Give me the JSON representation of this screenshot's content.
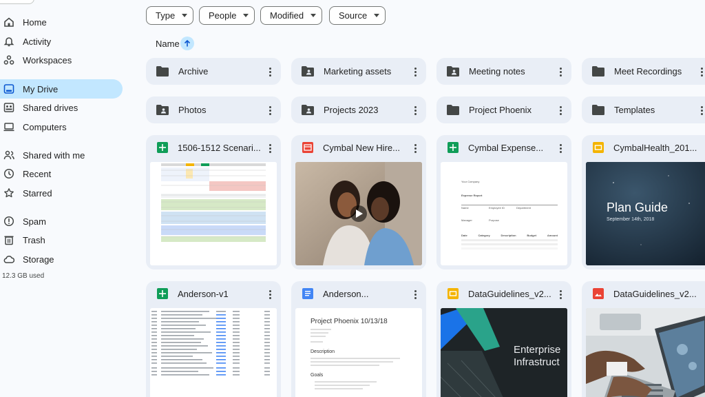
{
  "sidebar": {
    "items": [
      {
        "label": "Home",
        "icon": "home-icon"
      },
      {
        "label": "Activity",
        "icon": "bell-icon"
      },
      {
        "label": "Workspaces",
        "icon": "workspaces-icon"
      },
      {
        "label": "My Drive",
        "icon": "drive-icon",
        "active": true
      },
      {
        "label": "Shared drives",
        "icon": "shared-drives-icon"
      },
      {
        "label": "Computers",
        "icon": "computer-icon"
      },
      {
        "label": "Shared with me",
        "icon": "people-icon"
      },
      {
        "label": "Recent",
        "icon": "clock-icon"
      },
      {
        "label": "Starred",
        "icon": "star-icon"
      },
      {
        "label": "Spam",
        "icon": "spam-icon"
      },
      {
        "label": "Trash",
        "icon": "trash-icon"
      },
      {
        "label": "Storage",
        "icon": "cloud-icon"
      }
    ],
    "storage_used": "12.3 GB used"
  },
  "filters": [
    "Type",
    "People",
    "Modified",
    "Source"
  ],
  "sort": {
    "label": "Name",
    "direction": "ascending"
  },
  "folders": [
    {
      "name": "Archive",
      "shared": false
    },
    {
      "name": "Marketing assets",
      "shared": true
    },
    {
      "name": "Meeting notes",
      "shared": true
    },
    {
      "name": "Meet Recordings",
      "shared": false
    },
    {
      "name": "Photos",
      "shared": true
    },
    {
      "name": "Projects 2023",
      "shared": true
    },
    {
      "name": "Project Phoenix",
      "shared": false
    },
    {
      "name": "Templates",
      "shared": false
    }
  ],
  "files": [
    {
      "name": "1506-1512 Scenari...",
      "type": "sheet"
    },
    {
      "name": "Cymbal New Hire...",
      "type": "video"
    },
    {
      "name": "Cymbal Expense...",
      "type": "sheet"
    },
    {
      "name": "CymbalHealth_201...",
      "type": "slides"
    },
    {
      "name": "Anderson-v1",
      "type": "sheet"
    },
    {
      "name": "Anderson...",
      "type": "doc"
    },
    {
      "name": "DataGuidelines_v2...",
      "type": "slides"
    },
    {
      "name": "DataGuidelines_v2...",
      "type": "image"
    }
  ],
  "thumbs": {
    "expense": {
      "company": "Your Company",
      "title": "Expense Report",
      "col1": [
        "Name",
        "Manager"
      ],
      "col2": [
        "Employee ID",
        "Purpose"
      ],
      "col3": [
        "Department"
      ],
      "table_headers": [
        "Date",
        "Category",
        "Description",
        "Budget",
        "Amount"
      ]
    },
    "plan_guide": {
      "title": "Plan Guide",
      "date": "September 14th, 2018"
    },
    "doc": {
      "title": "Project Phoenix 10/13/18",
      "section1": "Description",
      "section2": "Goals"
    },
    "enterprise": {
      "line1": "Enterprise",
      "line2": "Infrastruct"
    }
  },
  "colors": {
    "accent": "#c2e7ff",
    "card_bg": "#e9eef6",
    "page_bg": "#f8fafd"
  }
}
